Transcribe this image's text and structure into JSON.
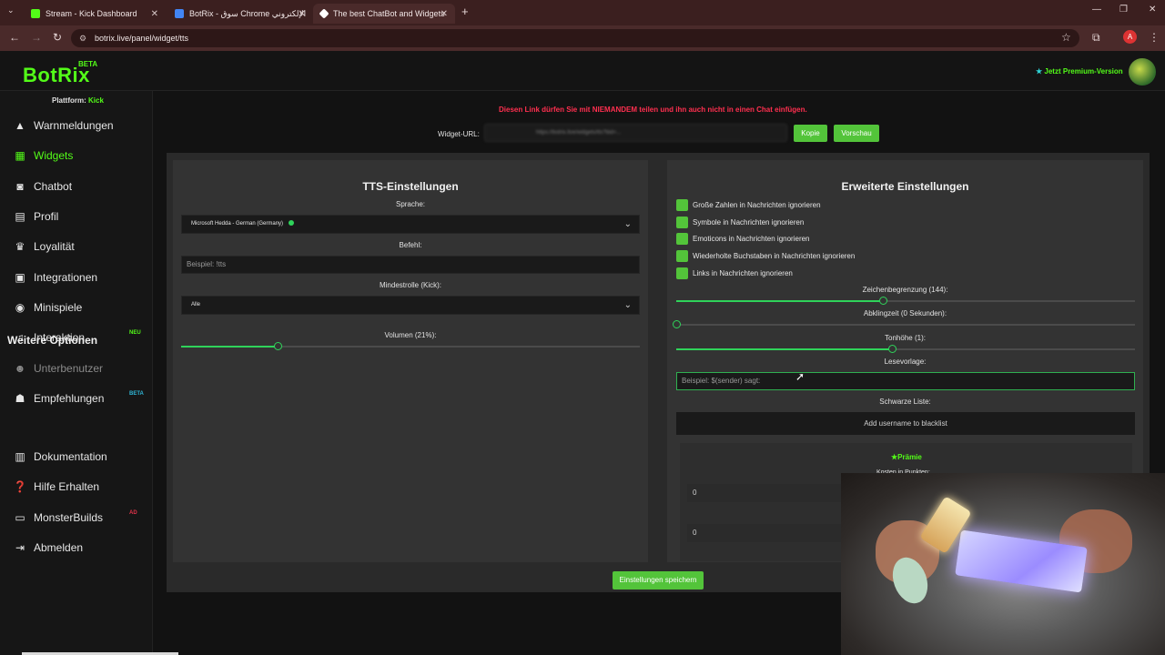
{
  "browser": {
    "tabs": [
      {
        "title": "Stream - Kick Dashboard",
        "favicon_color": "#53fc18"
      },
      {
        "title": "BotRix - سوق Chrome الإلكتروني",
        "favicon_color": "#4285f4"
      },
      {
        "title": "The best ChatBot and Widgets",
        "favicon_color": "#ffffff"
      }
    ],
    "url": "botrix.live/panel/widget/tts",
    "profile_initial": "A"
  },
  "header": {
    "logo": "BotRix",
    "logo_badge": "BETA",
    "premium_link": "Jetzt Premium-Version"
  },
  "sidebar": {
    "platform_label": "Plattform:",
    "platform_value": "Kick",
    "items": [
      {
        "label": "Warnmeldungen",
        "icon": "warning-icon"
      },
      {
        "label": "Widgets",
        "icon": "grid-icon"
      },
      {
        "label": "Chatbot",
        "icon": "robot-icon"
      },
      {
        "label": "Profil",
        "icon": "id-card-icon"
      },
      {
        "label": "Loyalität",
        "icon": "trophy-icon"
      },
      {
        "label": "Integrationen",
        "icon": "plug-icon"
      },
      {
        "label": "Minispiele",
        "icon": "gamepad-icon"
      },
      {
        "label": "Interaktion",
        "icon": "music-icon",
        "badge": "NEU"
      },
      {
        "label": "Unterbenutzer",
        "icon": "users-icon"
      },
      {
        "label": "Empfehlungen",
        "icon": "referral-icon",
        "badge": "BETA"
      }
    ],
    "section_title": "Weitere Optionen",
    "more_items": [
      {
        "label": "Dokumentation",
        "icon": "book-icon"
      },
      {
        "label": "Hilfe Erhalten",
        "icon": "help-icon"
      },
      {
        "label": "MonsterBuilds",
        "icon": "laptop-icon",
        "badge": "AD"
      },
      {
        "label": "Abmelden",
        "icon": "logout-icon"
      }
    ],
    "colors": {
      "accent": "#53fc18",
      "badge_neu": "#53fc18",
      "badge_beta": "#2fb5d6",
      "badge_ad": "#e2334a"
    }
  },
  "main": {
    "warning": "Diesen Link dürfen Sie mit NIEMANDEM teilen und ihn auch nicht in einen Chat einfügen.",
    "widget_url_label": "Widget-URL:",
    "widget_url_value": "https://botrix.live/widgets/tts?bid=...",
    "copy_button": "Kopie",
    "preview_button": "Vorschau",
    "tts": {
      "title": "TTS-Einstellungen",
      "language_label": "Sprache:",
      "language_value": "Microsoft Hedda - German (Germany)",
      "command_label": "Befehl:",
      "command_placeholder": "Beispiel: !tts",
      "min_role_label": "Mindestrolle (Kick):",
      "min_role_value": "Alle",
      "volume_label": "Volumen (21%):",
      "volume_value": 0.21
    },
    "advanced": {
      "title": "Erweiterte Einstellungen",
      "checkboxes": [
        "Große Zahlen in Nachrichten ignorieren",
        "Symbole in Nachrichten ignorieren",
        "Emoticons in Nachrichten ignorieren",
        "Wiederholte Buchstaben in Nachrichten ignorieren",
        "Links in Nachrichten ignorieren"
      ],
      "char_limit_label": "Zeichenbegrenzung (144):",
      "char_limit_fraction": 0.45,
      "cooldown_label": "Abklingzeit (0 Sekunden):",
      "cooldown_fraction": 0.0,
      "pitch_label": "Tonhöhe (1):",
      "pitch_fraction": 0.47,
      "template_label": "Lesevorlage:",
      "template_placeholder": "Beispiel: $(sender) sagt:",
      "blacklist_label": "Schwarze Liste:",
      "blacklist_button": "Add username to blacklist",
      "reward_title": "Prämie",
      "reward_subtitle": "Kosten in Punkten:",
      "reward_values": [
        "0",
        "0"
      ]
    },
    "save_button": "Einstellungen speichern"
  }
}
